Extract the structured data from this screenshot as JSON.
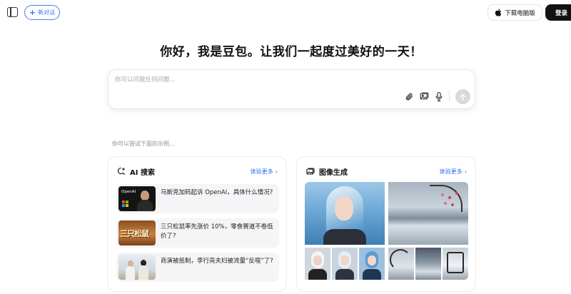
{
  "topbar": {
    "new_chat_label": "新对话",
    "download_label": "下载电脑版",
    "login_label": "登录"
  },
  "greeting": "你好，我是豆包。让我们一起度过美好的一天！",
  "composer": {
    "placeholder": "你可以问我任何问题..."
  },
  "examples_hint": "你可以尝试下面的示例...",
  "cards": {
    "search": {
      "title": "AI 搜索",
      "more_label": "体验更多",
      "items": [
        {
          "title": "马斯克加码起诉 OpenAI，具体什么情况?",
          "thumb_label": "OpenAI"
        },
        {
          "title": "三只松鼠率先涨价 10%，零食赛道不卷低价了?",
          "thumb_label": "三只松鼠"
        },
        {
          "title": "商演被抵制，李行亮夫妇被流量“反噬”了?"
        }
      ]
    },
    "image": {
      "title": "图像生成",
      "more_label": "体验更多"
    }
  },
  "colors": {
    "accent": "#3b6ef5",
    "login_bg": "#111111"
  }
}
